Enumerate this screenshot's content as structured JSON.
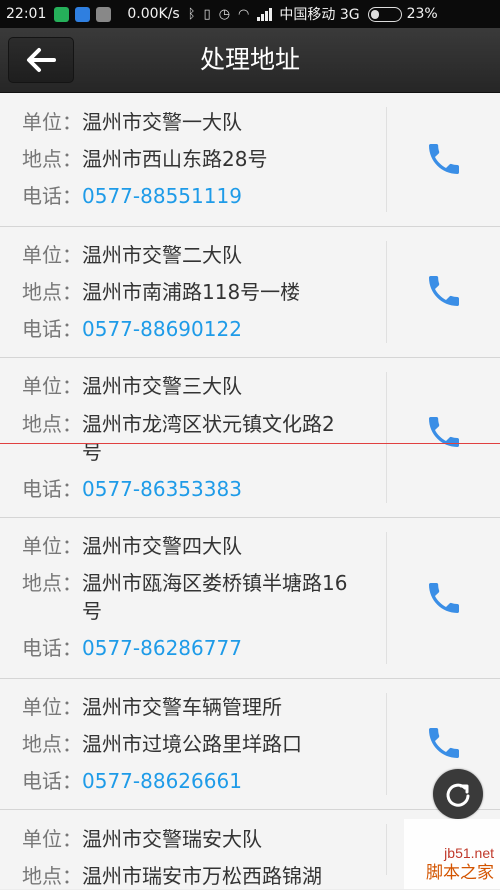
{
  "status_bar": {
    "time": "22:01",
    "speed": "0.00K/s",
    "carrier": "中国移动 3G",
    "battery": "23%"
  },
  "header": {
    "title": "处理地址"
  },
  "labels": {
    "unit": "单位：",
    "address": "地点：",
    "phone": "电话："
  },
  "items": [
    {
      "unit": "温州市交警一大队",
      "address": "温州市西山东路28号",
      "phone": "0577-88551119"
    },
    {
      "unit": "温州市交警二大队",
      "address": "温州市南浦路118号一楼",
      "phone": "0577-88690122"
    },
    {
      "unit": "温州市交警三大队",
      "address": "温州市龙湾区状元镇文化路2号",
      "phone": "0577-86353383"
    },
    {
      "unit": "温州市交警四大队",
      "address": "温州市瓯海区娄桥镇半塘路16号",
      "phone": "0577-86286777"
    },
    {
      "unit": "温州市交警车辆管理所",
      "address": "温州市过境公路里垟路口",
      "phone": "0577-88626661"
    },
    {
      "unit": "温州市交警瑞安大队",
      "address": "温州市瑞安市万松西路锦湖"
    }
  ],
  "watermark": {
    "url": "jb51.net",
    "name": "脚本之家"
  },
  "icons": {
    "back": "arrow-left-icon",
    "call": "phone-icon",
    "refresh": "refresh-icon"
  },
  "colors": {
    "phone_text": "#1e9be8",
    "call_icon": "#3a8ee6",
    "header_bg": "#2f2f2f"
  }
}
